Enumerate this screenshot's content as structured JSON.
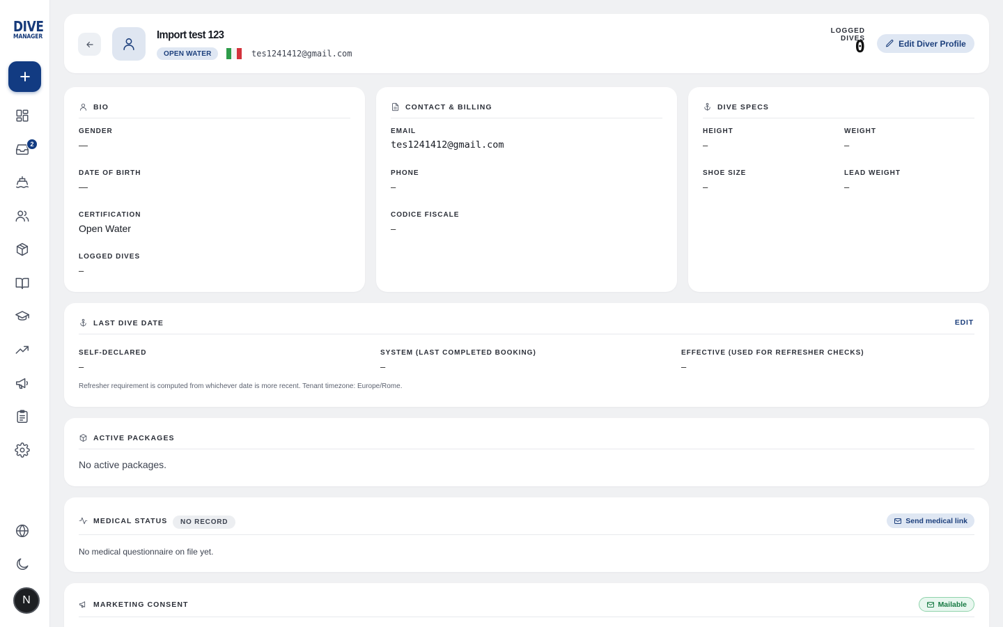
{
  "app": {
    "logo_line1": "DIVE",
    "logo_line2": "MANAGER",
    "notification_count": "2",
    "user_initial": "N"
  },
  "colors": {
    "brand": "#123b82",
    "accent_soft": "#dfe7f3",
    "success": "#177a43"
  },
  "sidebar": {
    "new_button_icon": "plus-icon",
    "items": [
      {
        "icon": "dashboard-icon"
      },
      {
        "icon": "inbox-icon"
      },
      {
        "icon": "boat-icon"
      },
      {
        "icon": "users-icon"
      },
      {
        "icon": "package-icon"
      },
      {
        "icon": "book-icon"
      },
      {
        "icon": "graduation-cap-icon"
      },
      {
        "icon": "trending-up-icon"
      },
      {
        "icon": "megaphone-icon"
      },
      {
        "icon": "clipboard-icon"
      },
      {
        "icon": "settings-icon"
      }
    ],
    "bottom": [
      {
        "icon": "globe-icon"
      },
      {
        "icon": "moon-icon"
      }
    ]
  },
  "header": {
    "name": "Import test 123",
    "level": "OPEN WATER",
    "flag": "italy-flag",
    "email": "tes1241412@gmail.com",
    "logged_dives_label": "LOGGED DIVES",
    "logged_dives_value": "0",
    "edit_button": "Edit Diver Profile"
  },
  "bio": {
    "title": "BIO",
    "gender_label": "GENDER",
    "gender_value": "—",
    "dob_label": "DATE OF BIRTH",
    "dob_value": "—",
    "cert_label": "CERTIFICATION",
    "cert_value": "Open Water",
    "dives_label": "LOGGED DIVES",
    "dives_value": "–"
  },
  "contact": {
    "title": "CONTACT & BILLING",
    "email_label": "EMAIL",
    "email_value": "tes1241412@gmail.com",
    "phone_label": "PHONE",
    "phone_value": "–",
    "cf_label": "CODICE FISCALE",
    "cf_value": "–"
  },
  "specs": {
    "title": "DIVE SPECS",
    "height_label": "HEIGHT",
    "height_value": "–",
    "weight_label": "WEIGHT",
    "weight_value": "–",
    "shoe_label": "SHOE SIZE",
    "shoe_value": "–",
    "lead_label": "LEAD WEIGHT",
    "lead_value": "–"
  },
  "last_dive": {
    "title": "LAST DIVE DATE",
    "edit": "EDIT",
    "self_label": "SELF-DECLARED",
    "self_value": "–",
    "system_label": "SYSTEM (LAST COMPLETED BOOKING)",
    "system_value": "–",
    "effective_label": "EFFECTIVE (USED FOR REFRESHER CHECKS)",
    "effective_value": "–",
    "note": "Refresher requirement is computed from whichever date is more recent. Tenant timezone: Europe/Rome."
  },
  "packages": {
    "title": "ACTIVE PACKAGES",
    "empty": "No active packages."
  },
  "medical": {
    "title": "MEDICAL STATUS",
    "status": "NO RECORD",
    "send_button": "Send medical link",
    "empty": "No medical questionnaire on file yet."
  },
  "marketing": {
    "title": "MARKETING CONSENT",
    "status": "Mailable"
  }
}
